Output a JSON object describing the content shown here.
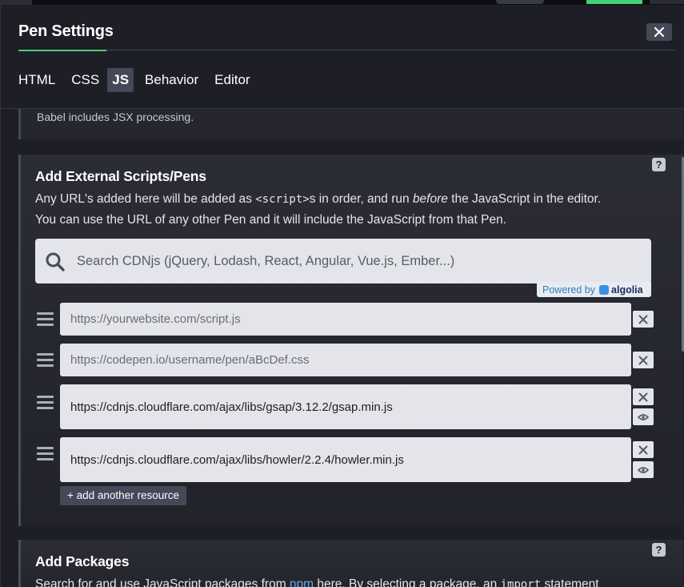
{
  "modal": {
    "title": "Pen Settings",
    "close_label": "×"
  },
  "tabs": [
    {
      "label": "HTML"
    },
    {
      "label": "CSS"
    },
    {
      "label": "JS",
      "active": true
    },
    {
      "label": "Behavior"
    },
    {
      "label": "Editor"
    }
  ],
  "preprocessor_note": "Babel includes JSX processing.",
  "external_scripts": {
    "title": "Add External Scripts/Pens",
    "help": "?",
    "desc_1": "Any URL's added here will be added as ",
    "desc_code": "<script>",
    "desc_2": "s in order, and run ",
    "desc_em": "before",
    "desc_3": " the JavaScript in the editor.",
    "desc_line2": "You can use the URL of any other Pen and it will include the JavaScript from that Pen.",
    "search_placeholder": "Search CDNjs (jQuery, Lodash, React, Angular, Vue.js, Ember...)",
    "search_value": "",
    "powered_by": "Powered by",
    "algolia": "algolia",
    "resources": [
      {
        "value": "",
        "placeholder": "https://yourwebsite.com/script.js"
      },
      {
        "value": "",
        "placeholder": "https://codepen.io/username/pen/aBcDef.css"
      },
      {
        "value": "https://cdnjs.cloudflare.com/ajax/libs/gsap/3.12.2/gsap.min.js",
        "placeholder": ""
      },
      {
        "value": "https://cdnjs.cloudflare.com/ajax/libs/howler/2.2.4/howler.min.js",
        "placeholder": ""
      }
    ],
    "add_resource_label": "+ add another resource"
  },
  "packages": {
    "title": "Add Packages",
    "help": "?",
    "desc_1": "Search for and use JavaScript packages from ",
    "desc_link": "npm",
    "desc_2": " here. By selecting a package, an ",
    "desc_code": "import",
    "desc_3": " statement"
  },
  "colors": {
    "accent_green": "#47cf73",
    "background": "#1e1f26",
    "card": "#2b2c34",
    "button": "#444857"
  },
  "icons": {
    "close": "close-icon",
    "search": "search-icon",
    "drag": "drag-handle-icon",
    "remove": "remove-icon",
    "view": "eye-icon",
    "help": "help-icon"
  }
}
